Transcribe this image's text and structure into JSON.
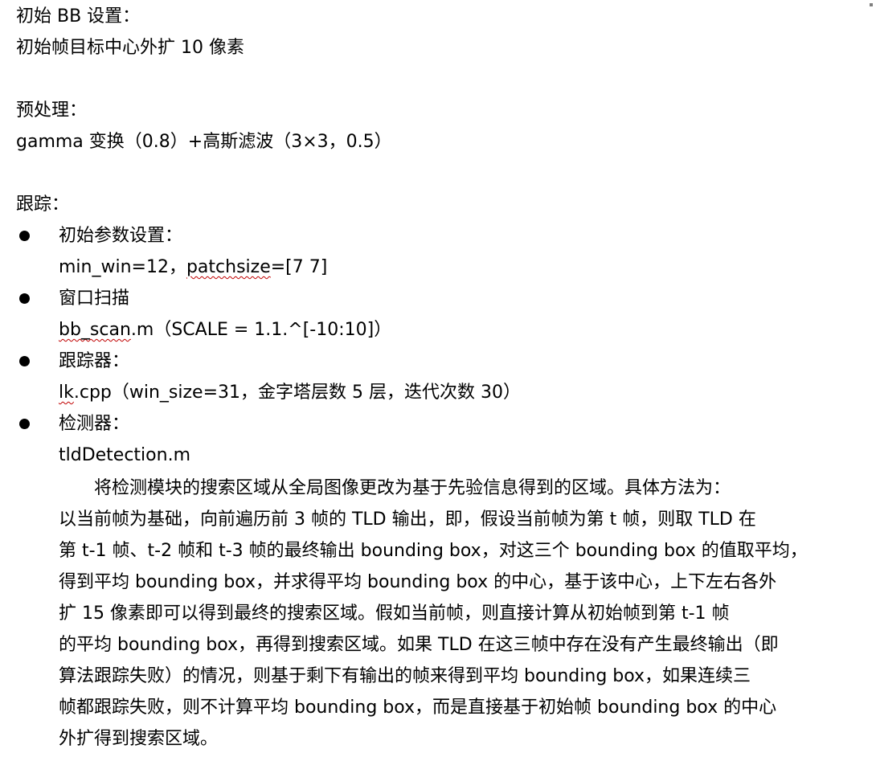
{
  "doc": {
    "bb_heading": "初始 BB 设置：",
    "bb_text": "初始帧目标中心外扩 10 像素",
    "pre_heading": "预处理：",
    "pre_text": "gamma 变换（0.8）+高斯滤波（3×3，0.5）",
    "track_heading": "跟踪：",
    "bullets": [
      {
        "title": "初始参数设置：",
        "detail_pre": "min_win=12，",
        "detail_squiggle": "patchsize",
        "detail_post": "=[7 7]"
      },
      {
        "title": "窗口扫描",
        "detail_pre": "",
        "detail_squiggle": "bb_scan",
        "detail_post": ".m（SCALE = 1.1.^[-10:10]）"
      },
      {
        "title": "跟踪器：",
        "detail_pre": "",
        "detail_squiggle": "lk",
        "detail_post": ".cpp（win_size=31，金字塔层数 5 层，迭代次数 30）"
      },
      {
        "title": "检测器：",
        "detail_pre": "",
        "detail_squiggle": "",
        "detail_post": "tldDetection.m"
      }
    ],
    "paragraph_lines": [
      "　　将检测模块的搜索区域从全局图像更改为基于先验信息得到的区域。具体方法为：",
      "以当前帧为基础，向前遍历前 3 帧的 TLD 输出，即，假设当前帧为第 t 帧，则取 TLD 在",
      "第 t-1 帧、t-2 帧和 t-3 帧的最终输出 bounding box，对这三个 bounding box 的值取平均，",
      "得到平均 bounding box，并求得平均 bounding box 的中心，基于该中心，上下左右各外",
      "扩 15 像素即可以得到最终的搜索区域。假如当前帧，则直接计算从初始帧到第 t-1 帧",
      "的平均 bounding box，再得到搜索区域。如果 TLD 在这三帧中存在没有产生最终输出（即",
      "算法跟踪失败）的情况，则基于剩下有输出的帧来得到平均 bounding box，如果连续三",
      "帧都跟踪失败，则不计算平均 bounding box，而是直接基于初始帧 bounding box 的中心",
      "外扩得到搜索区域。"
    ]
  }
}
